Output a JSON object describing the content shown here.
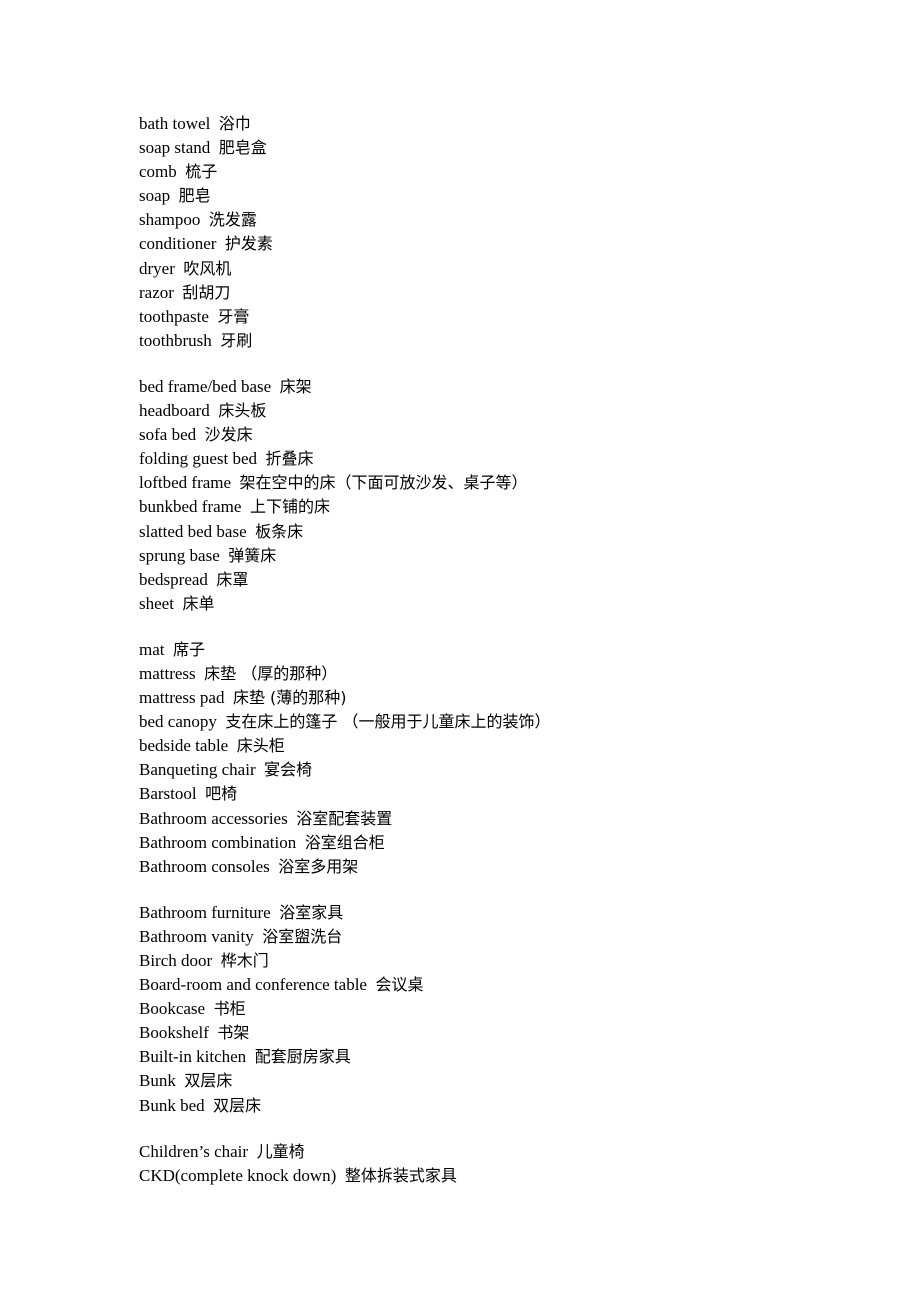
{
  "document": {
    "groups": [
      {
        "entries": [
          {
            "en": "bath towel",
            "zh": "浴巾"
          },
          {
            "en": "soap stand",
            "zh": "肥皂盒"
          },
          {
            "en": "comb",
            "zh": "梳子"
          },
          {
            "en": "soap",
            "zh": "肥皂"
          },
          {
            "en": "shampoo",
            "zh": "洗发露"
          },
          {
            "en": "conditioner",
            "zh": "护发素"
          },
          {
            "en": "dryer",
            "zh": "吹风机"
          },
          {
            "en": "razor",
            "zh": "刮胡刀"
          },
          {
            "en": "toothpaste",
            "zh": "牙膏"
          },
          {
            "en": "toothbrush",
            "zh": "牙刷"
          }
        ]
      },
      {
        "entries": [
          {
            "en": "bed frame/bed base",
            "zh": "床架"
          },
          {
            "en": "headboard",
            "zh": "床头板"
          },
          {
            "en": "sofa bed",
            "zh": "沙发床"
          },
          {
            "en": "folding guest bed",
            "zh": "折叠床"
          },
          {
            "en": "loftbed frame",
            "zh": "架在空中的床（下面可放沙发、桌子等）"
          },
          {
            "en": "bunkbed frame",
            "zh": "上下铺的床"
          },
          {
            "en": "slatted bed base",
            "zh": "板条床"
          },
          {
            "en": "sprung base",
            "zh": "弹簧床"
          },
          {
            "en": "bedspread",
            "zh": "床罩"
          },
          {
            "en": "sheet",
            "zh": "床单"
          }
        ]
      },
      {
        "entries": [
          {
            "en": "mat",
            "zh": "席子"
          },
          {
            "en": "mattress",
            "zh": "床垫 （厚的那种）"
          },
          {
            "en": "mattress pad",
            "zh": "床垫 (薄的那种)"
          },
          {
            "en": "bed canopy",
            "zh": "支在床上的篷子 （一般用于儿童床上的装饰）"
          },
          {
            "en": "bedside table",
            "zh": "床头柜"
          },
          {
            "en": "Banqueting chair",
            "zh": "宴会椅"
          },
          {
            "en": "Barstool",
            "zh": "吧椅"
          },
          {
            "en": "Bathroom accessories",
            "zh": "浴室配套装置"
          },
          {
            "en": "Bathroom combination",
            "zh": "浴室组合柜"
          },
          {
            "en": "Bathroom consoles",
            "zh": "浴室多用架"
          }
        ]
      },
      {
        "entries": [
          {
            "en": "Bathroom furniture",
            "zh": "浴室家具"
          },
          {
            "en": "Bathroom vanity",
            "zh": "浴室盥洗台"
          },
          {
            "en": "Birch door",
            "zh": "桦木门"
          },
          {
            "en": "Board-room and conference table",
            "zh": "会议桌"
          },
          {
            "en": "Bookcase",
            "zh": "书柜"
          },
          {
            "en": "Bookshelf",
            "zh": "书架"
          },
          {
            "en": "Built-in kitchen",
            "zh": "配套厨房家具"
          },
          {
            "en": "Bunk",
            "zh": "双层床"
          },
          {
            "en": "Bunk bed",
            "zh": "双层床"
          }
        ]
      },
      {
        "entries": [
          {
            "en": "Children’s chair",
            "zh": "儿童椅"
          },
          {
            "en": "CKD(complete knock down)",
            "zh": "整体拆装式家具"
          }
        ]
      }
    ]
  }
}
